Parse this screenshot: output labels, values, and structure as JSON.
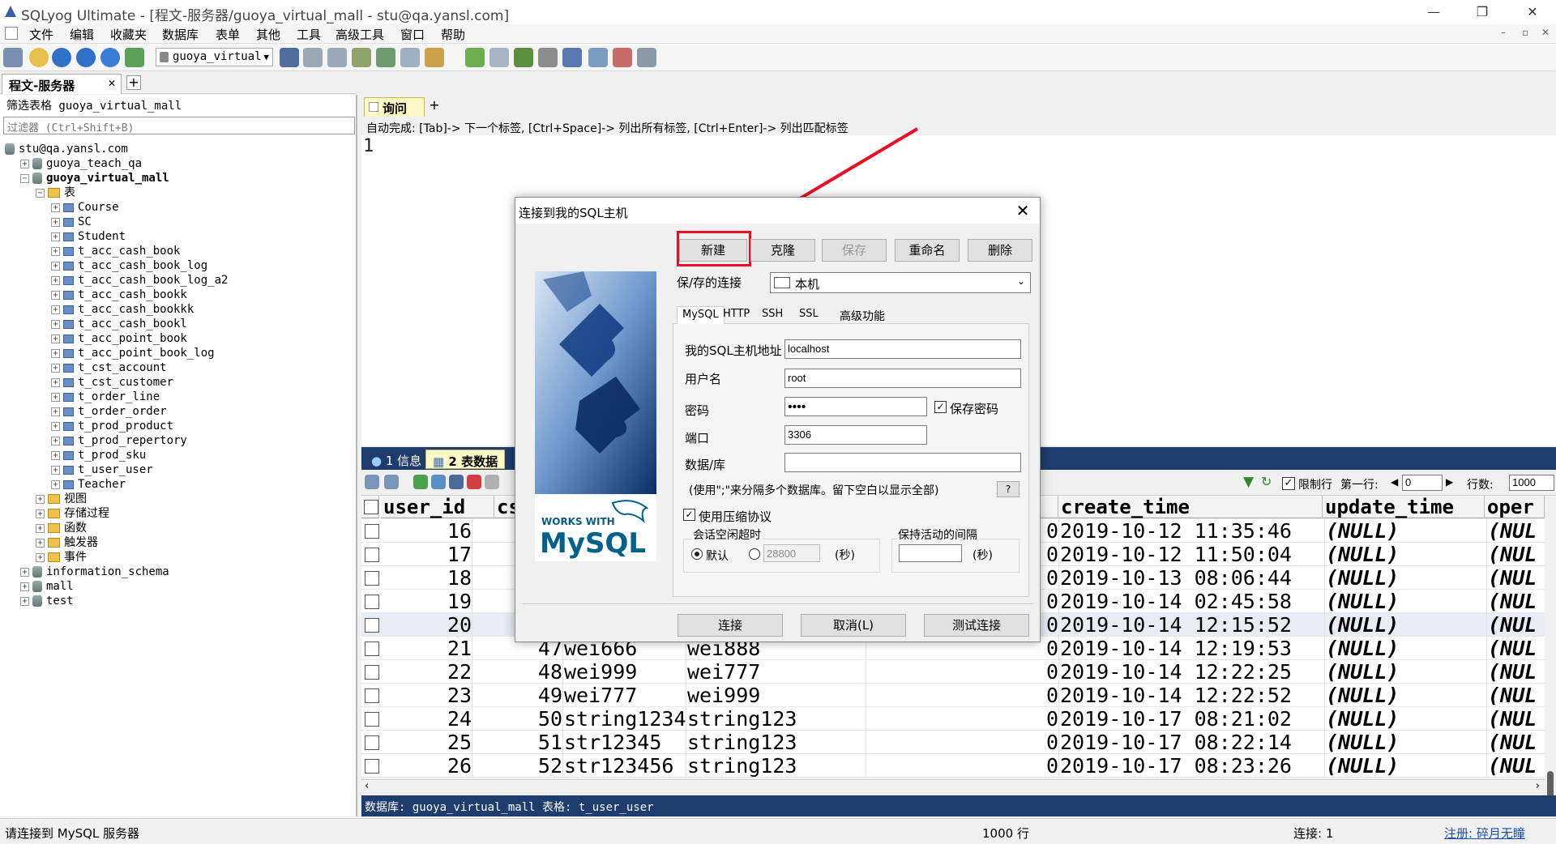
{
  "window": {
    "title": "SQLyog Ultimate - [程文-服务器/guoya_virtual_mall - stu@qa.yansl.com]",
    "min": "—",
    "restore": "❐",
    "close": "✕"
  },
  "menu": [
    "文件",
    "编辑",
    "收藏夹",
    "数据库",
    "表单",
    "其他",
    "工具",
    "高级工具",
    "窗口",
    "帮助"
  ],
  "toolbar": {
    "database": "guoya_virtual"
  },
  "connection_tab": {
    "label": "程文-服务器",
    "close": "✕",
    "add": "+"
  },
  "object_browser": {
    "filter_label": "筛选表格 guoya_virtual_mall",
    "filter_placeholder": "过滤器 (Ctrl+Shift+B)",
    "tree": [
      {
        "text": "stu@qa.yansl.com",
        "indent": 0,
        "kind": "server"
      },
      {
        "text": "guoya_teach_qa",
        "indent": 1,
        "kind": "db",
        "exp": "+"
      },
      {
        "text": "guoya_virtual_mall",
        "indent": 1,
        "kind": "db",
        "exp": "−",
        "bold": true
      },
      {
        "text": "表",
        "indent": 2,
        "kind": "folder",
        "exp": "−"
      },
      {
        "text": "Course",
        "indent": 3,
        "kind": "table",
        "exp": "+"
      },
      {
        "text": "SC",
        "indent": 3,
        "kind": "table",
        "exp": "+"
      },
      {
        "text": "Student",
        "indent": 3,
        "kind": "table",
        "exp": "+"
      },
      {
        "text": "t_acc_cash_book",
        "indent": 3,
        "kind": "table",
        "exp": "+"
      },
      {
        "text": "t_acc_cash_book_log",
        "indent": 3,
        "kind": "table",
        "exp": "+"
      },
      {
        "text": "t_acc_cash_book_log_a2",
        "indent": 3,
        "kind": "table",
        "exp": "+"
      },
      {
        "text": "t_acc_cash_bookk",
        "indent": 3,
        "kind": "table",
        "exp": "+"
      },
      {
        "text": "t_acc_cash_bookkk",
        "indent": 3,
        "kind": "table",
        "exp": "+"
      },
      {
        "text": "t_acc_cash_bookl",
        "indent": 3,
        "kind": "table",
        "exp": "+"
      },
      {
        "text": "t_acc_point_book",
        "indent": 3,
        "kind": "table",
        "exp": "+"
      },
      {
        "text": "t_acc_point_book_log",
        "indent": 3,
        "kind": "table",
        "exp": "+"
      },
      {
        "text": "t_cst_account",
        "indent": 3,
        "kind": "table",
        "exp": "+"
      },
      {
        "text": "t_cst_customer",
        "indent": 3,
        "kind": "table",
        "exp": "+"
      },
      {
        "text": "t_order_line",
        "indent": 3,
        "kind": "table",
        "exp": "+"
      },
      {
        "text": "t_order_order",
        "indent": 3,
        "kind": "table",
        "exp": "+"
      },
      {
        "text": "t_prod_product",
        "indent": 3,
        "kind": "table",
        "exp": "+"
      },
      {
        "text": "t_prod_repertory",
        "indent": 3,
        "kind": "table",
        "exp": "+"
      },
      {
        "text": "t_prod_sku",
        "indent": 3,
        "kind": "table",
        "exp": "+"
      },
      {
        "text": "t_user_user",
        "indent": 3,
        "kind": "table",
        "exp": "+"
      },
      {
        "text": "Teacher",
        "indent": 3,
        "kind": "table",
        "exp": "+"
      },
      {
        "text": "视图",
        "indent": 2,
        "kind": "folder",
        "exp": "+"
      },
      {
        "text": "存储过程",
        "indent": 2,
        "kind": "folder",
        "exp": "+"
      },
      {
        "text": "函数",
        "indent": 2,
        "kind": "folder",
        "exp": "+"
      },
      {
        "text": "触发器",
        "indent": 2,
        "kind": "folder",
        "exp": "+"
      },
      {
        "text": "事件",
        "indent": 2,
        "kind": "folder",
        "exp": "+"
      },
      {
        "text": "information_schema",
        "indent": 1,
        "kind": "db",
        "exp": "+"
      },
      {
        "text": "mall",
        "indent": 1,
        "kind": "db",
        "exp": "+"
      },
      {
        "text": "test",
        "indent": 1,
        "kind": "db",
        "exp": "+"
      }
    ]
  },
  "query": {
    "tab": "询问",
    "add": "+",
    "autocomplete": "自动完成: [Tab]-> 下一个标签, [Ctrl+Space]-> 列出所有标签, [Ctrl+Enter]-> 列出匹配标签",
    "line": "1"
  },
  "results": {
    "tab1": "1 信息",
    "tab2": "2 表数据",
    "limit_label": "限制行",
    "first_row_label": "第一行:",
    "first_row": "0",
    "rows_label": "行数:",
    "rows": "1000",
    "columns": [
      "user_id",
      "cs",
      "",
      "",
      "",
      "create_time",
      "update_time",
      "oper"
    ],
    "rows_data": [
      [
        "16",
        "",
        "",
        "",
        "0",
        "2019-10-12 11:35:46",
        "(NULL)",
        "(NUL"
      ],
      [
        "17",
        "",
        "",
        "",
        "0",
        "2019-10-12 11:50:04",
        "(NULL)",
        "(NUL"
      ],
      [
        "18",
        "",
        "",
        "",
        "0",
        "2019-10-13 08:06:44",
        "(NULL)",
        "(NUL"
      ],
      [
        "19",
        "",
        "",
        "",
        "0",
        "2019-10-14 02:45:58",
        "(NULL)",
        "(NUL"
      ],
      [
        "20",
        "",
        "",
        "",
        "0",
        "2019-10-14 12:15:52",
        "(NULL)",
        "(NUL"
      ],
      [
        "21",
        "47",
        "wei666",
        "wei888",
        "0",
        "2019-10-14 12:19:53",
        "(NULL)",
        "(NUL"
      ],
      [
        "22",
        "48",
        "wei999",
        "wei777",
        "0",
        "2019-10-14 12:22:25",
        "(NULL)",
        "(NUL"
      ],
      [
        "23",
        "49",
        "wei777",
        "wei999",
        "0",
        "2019-10-14 12:22:52",
        "(NULL)",
        "(NUL"
      ],
      [
        "24",
        "50",
        "string1234",
        "string123",
        "0",
        "2019-10-17 08:21:02",
        "(NULL)",
        "(NUL"
      ],
      [
        "25",
        "51",
        "str12345",
        "string123",
        "0",
        "2019-10-17 08:22:14",
        "(NULL)",
        "(NUL"
      ],
      [
        "26",
        "52",
        "str123456",
        "string123",
        "0",
        "2019-10-17 08:23:26",
        "(NULL)",
        "(NUL"
      ]
    ],
    "db_info": "数据库: guoya_virtual_mall  表格: t_user_user"
  },
  "status": {
    "left": "请连接到 MySQL 服务器",
    "rows": "1000 行",
    "conn": "连接: 1",
    "reg": "注册: 碎月无瞳"
  },
  "dialog": {
    "title": "连接到我的SQL主机",
    "close": "✕",
    "btn_new": "新建",
    "btn_clone": "克隆",
    "btn_save": "保存",
    "btn_rename": "重命名",
    "btn_delete": "删除",
    "saved_label": "保/存的连接",
    "saved_value": "本机",
    "tabs": [
      "MySQL",
      "HTTP",
      "SSH",
      "SSL",
      "高级功能"
    ],
    "host_label": "我的SQL主机地址",
    "host": "localhost",
    "user_label": "用户名",
    "user": "root",
    "pwd_label": "密码",
    "pwd": "••••",
    "save_pwd": "保存密码",
    "port_label": "端口",
    "port": "3306",
    "db_label": "数据/库",
    "db": "",
    "hint": "(使用\";\"来分隔多个数据库。留下空白以显示全部)",
    "help": "?",
    "compress": "使用压缩协议",
    "timeout_label": "会话空闲超时",
    "default": "默认",
    "timeout_val": "28800",
    "sec": "(秒)",
    "keepalive_label": "保持活动的间隔",
    "keepalive_val": "",
    "sec2": "(秒)",
    "btn_connect": "连接",
    "btn_cancel": "取消(L)",
    "btn_test": "测试连接",
    "logo_works": "WORKS WITH",
    "logo_mysql": "MySQL"
  },
  "colors": {
    "highlight": "#e81123",
    "navy": "#1e3c6e",
    "tab_yellow": "#fff9c8"
  }
}
